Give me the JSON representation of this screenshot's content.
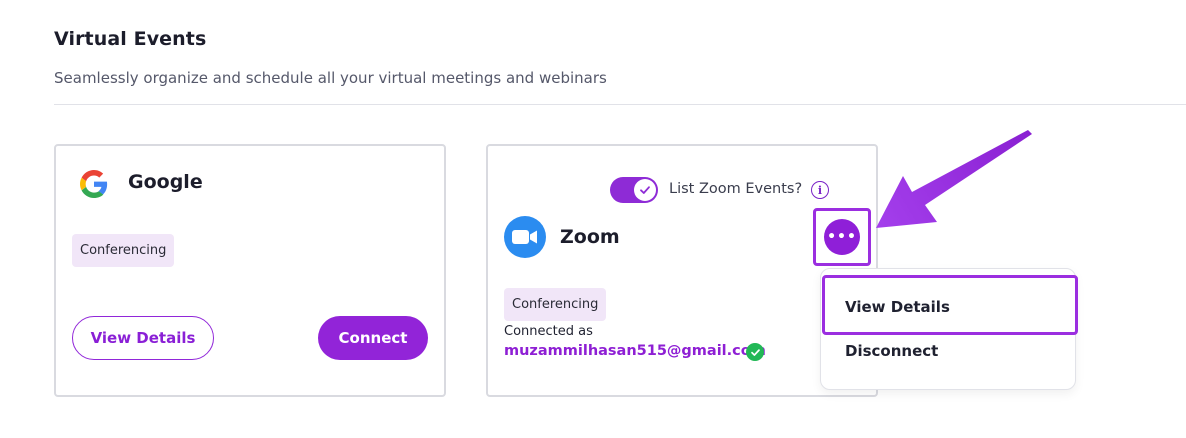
{
  "section": {
    "title": "Virtual Events",
    "subtitle": "Seamlessly organize and schedule all your virtual meetings and webinars"
  },
  "google_card": {
    "name": "Google",
    "tag": "Conferencing",
    "view_details_label": "View Details",
    "connect_label": "Connect",
    "icon": "google-logo"
  },
  "zoom_card": {
    "name": "Zoom",
    "toggle_label": "List Zoom Events?",
    "toggle_on": true,
    "info_glyph": "i",
    "more_glyph": "•••",
    "tag": "Conferencing",
    "connected_as_label": "Connected as",
    "email": "muzammilhasan515@gmail.com",
    "icon": "zoom-logo"
  },
  "dropdown": {
    "items": [
      {
        "label": "View Details"
      },
      {
        "label": "Disconnect"
      }
    ]
  },
  "colors": {
    "accent": "#9224d8",
    "highlight": "#9b2ee0",
    "tag_bg": "#f1e6f8",
    "success": "#22b856",
    "zoom_blue": "#2b8cf0"
  }
}
